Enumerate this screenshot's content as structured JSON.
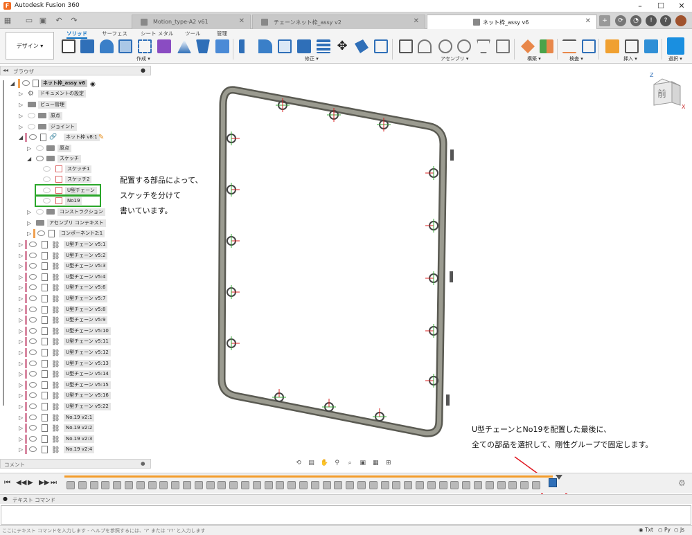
{
  "app": {
    "title": "Autodesk Fusion 360",
    "icon_letter": "F"
  },
  "tabs": [
    {
      "label": "Motion_type-A2 v61"
    },
    {
      "label": "チェーンネット枠_assy v2"
    },
    {
      "label": "ネット枠_assy v6"
    }
  ],
  "toolbar": {
    "workspace": "デザイン",
    "tabs": [
      "ソリッド",
      "サーフェス",
      "シート メタル",
      "ツール",
      "管理"
    ],
    "groups": [
      "作成",
      "修正",
      "アセンブリ",
      "構築",
      "検査",
      "挿入",
      "選択"
    ]
  },
  "browser": {
    "header": "ブラウザ",
    "root": "ネット枠_assy v6",
    "items": [
      {
        "label": "ドキュメントの設定"
      },
      {
        "label": "ビュー管理"
      },
      {
        "label": "原点"
      },
      {
        "label": "ジョイント"
      },
      {
        "label": "ネット枠 v8:1"
      },
      {
        "label": "原点"
      },
      {
        "label": "スケッチ"
      },
      {
        "label": "スケッチ1"
      },
      {
        "label": "スケッチ2"
      },
      {
        "label": "U型チェーン"
      },
      {
        "label": "No19"
      },
      {
        "label": "コンストラクション"
      },
      {
        "label": "アセンブリ コンテキスト"
      },
      {
        "label": "コンポーネント2:1"
      }
    ],
    "components": [
      "U型チェーン v5:1",
      "U型チェーン v5:2",
      "U型チェーン v5:3",
      "U型チェーン v5:4",
      "U型チェーン v5:6",
      "U型チェーン v5:7",
      "U型チェーン v5:8",
      "U型チェーン v5:9",
      "U型チェーン v5:10",
      "U型チェーン v5:11",
      "U型チェーン v5:12",
      "U型チェーン v5:13",
      "U型チェーン v5:14",
      "U型チェーン v5:15",
      "U型チェーン v5:16",
      "U型チェーン v5:22",
      "No.19 v2:1",
      "No.19 v2:2",
      "No.19 v2:3",
      "No.19 v2:4"
    ]
  },
  "annotations": {
    "left": [
      "配置する部品によって、",
      "スケッチを分けて",
      "書いています。"
    ],
    "right": [
      "U型チェーンとNo19を配置した最後に、",
      "全ての部品を選択して、剛性グループで固定します。"
    ]
  },
  "viewcube": {
    "face": "前",
    "axis_x": "X",
    "axis_z": "Z"
  },
  "comment_label": "コメント",
  "textcommand": {
    "label": "テキスト コマンド",
    "status": "ここにテキスト コマンドを入力します - ヘルプを参照するには、'?' または '??' と入力します",
    "modes": [
      "Txt",
      "Py",
      "Js"
    ]
  },
  "colors": {
    "accent": "#0a6fc2",
    "highlight": "#e0141e",
    "sketch_box": "#2aa62a",
    "timeline": "#f39c2b",
    "frame": "#8a8a80"
  }
}
